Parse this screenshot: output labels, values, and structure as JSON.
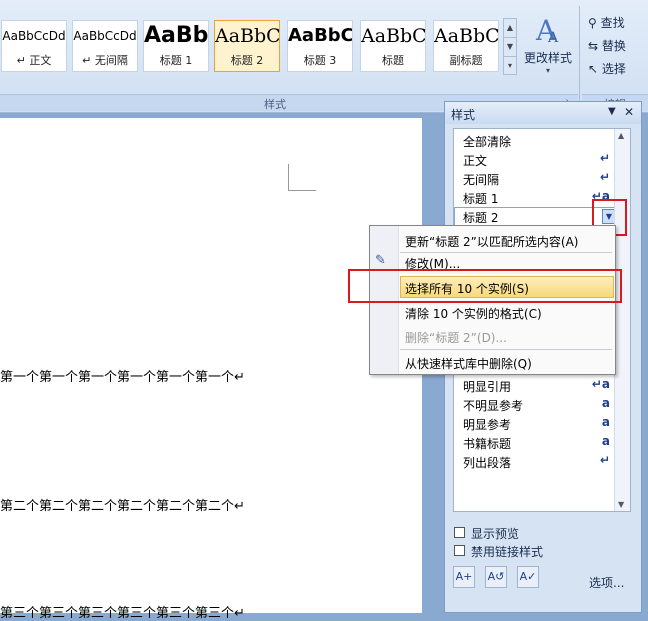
{
  "ribbon": {
    "styles": [
      {
        "sample": "AaBbCcDd",
        "name": "↵ 正文"
      },
      {
        "sample": "AaBbCcDd",
        "name": "↵ 无间隔"
      },
      {
        "sample": "AaBb",
        "name": "标题 1"
      },
      {
        "sample": "AaBbC",
        "name": "标题 2"
      },
      {
        "sample": "AaBbC",
        "name": "标题 3"
      },
      {
        "sample": "AaBbC",
        "name": "标题"
      },
      {
        "sample": "AaBbC",
        "name": "副标题"
      }
    ],
    "change_styles_label": "更改样式",
    "group_label": "样式",
    "find_label": "查找",
    "replace_label": "替换",
    "select_label": "选择",
    "editing_group_label": "编辑"
  },
  "document": {
    "lines": [
      "第一个第一个第一个第一个第一个第一个↵",
      "第二个第二个第二个第二个第二个第二个↵",
      "第三个第三个第三个第三个第三个第三个↵"
    ]
  },
  "styles_pane": {
    "title": "样式",
    "items": [
      {
        "label": "全部清除",
        "mark": ""
      },
      {
        "label": "正文",
        "mark": "↵"
      },
      {
        "label": "无间隔",
        "mark": "↵"
      },
      {
        "label": "标题 1",
        "mark": "↵a"
      },
      {
        "label": "标题 2",
        "mark": "↵a"
      },
      {
        "label": "明显引用",
        "mark": "↵a"
      },
      {
        "label": "不明显参考",
        "mark": "a"
      },
      {
        "label": "明显参考",
        "mark": "a"
      },
      {
        "label": "书籍标题",
        "mark": "a"
      },
      {
        "label": "列出段落",
        "mark": "↵"
      }
    ],
    "show_preview_label": "显示预览",
    "disable_linked_label": "禁用链接样式",
    "options_label": "选项..."
  },
  "context_menu": {
    "items": [
      {
        "label": "更新“标题 2”以匹配所选内容(A)"
      },
      {
        "label": "修改(M)..."
      },
      {
        "label": "选择所有 10 个实例(S)"
      },
      {
        "label": "清除 10 个实例的格式(C)"
      },
      {
        "label": "删除“标题 2”(D)..."
      },
      {
        "label": "从快速样式库中删除(Q)"
      }
    ]
  },
  "colors": {
    "highlight_box": "#d9181f",
    "menu_highlight": "#f9d879"
  }
}
